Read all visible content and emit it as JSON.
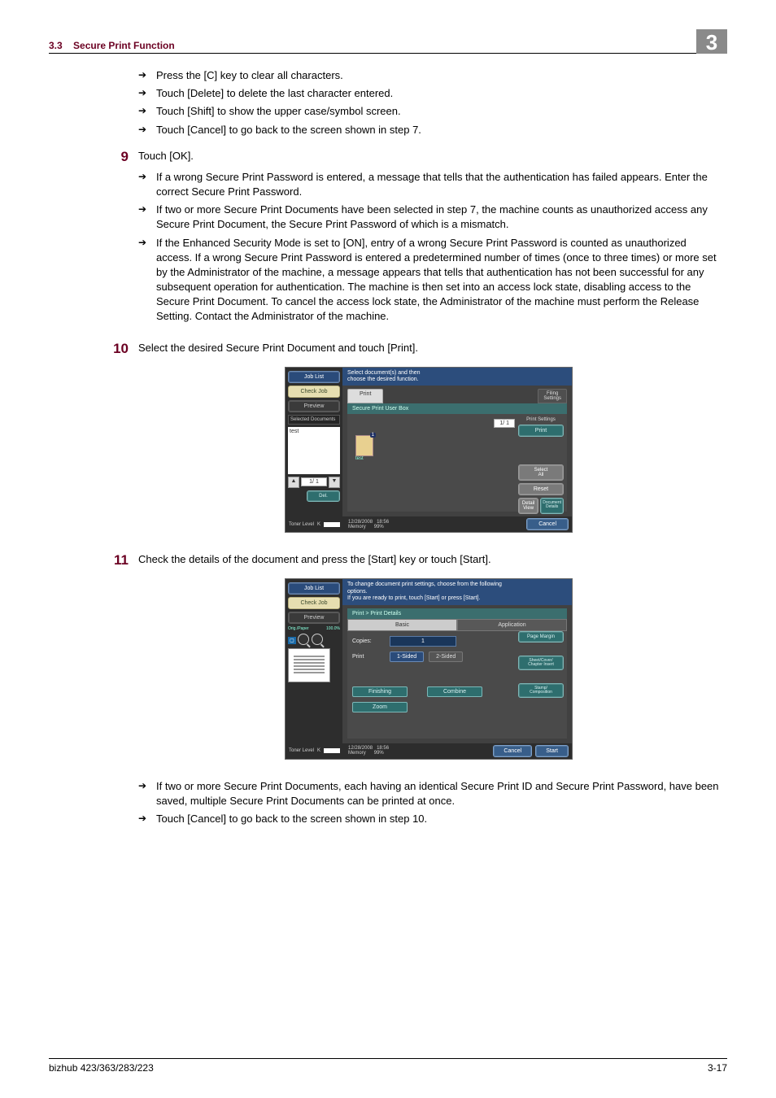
{
  "header": {
    "section_num": "3.3",
    "section_title": "Secure Print Function",
    "chapter": "3"
  },
  "intro_bullets": [
    "Press the [C] key to clear all characters.",
    "Touch [Delete] to delete the last character entered.",
    "Touch [Shift] to show the upper case/symbol screen.",
    "Touch [Cancel] to go back to the screen shown in step 7."
  ],
  "steps": {
    "s9": {
      "num": "9",
      "text": "Touch [OK].",
      "bullets": [
        "If a wrong Secure Print Password is entered, a message that tells that the authentication has failed appears. Enter the correct Secure Print Password.",
        "If two or more Secure Print Documents have been selected in step 7, the machine counts as unauthorized access any Secure Print Document, the Secure Print Password of which is a mismatch.",
        "If the Enhanced Security Mode is set to [ON], entry of a wrong Secure Print Password is counted as unauthorized access. If a wrong Secure Print Password is entered a predetermined number of times (once to three times) or more set by the Administrator of the machine, a message appears that tells that authentication has not been successful for any subsequent operation for authentication. The machine is then set into an access lock state, disabling access to the Secure Print Document. To cancel the access lock state, the Administrator of the machine must perform the Release Setting. Contact the Administrator of the machine."
      ]
    },
    "s10": {
      "num": "10",
      "text": "Select the desired Secure Print Document and touch [Print]."
    },
    "s11": {
      "num": "11",
      "text": "Check the details of the document and press the [Start] key or touch [Start].",
      "bullets": [
        "If two or more Secure Print Documents, each having an identical Secure Print ID and Secure Print Password, have been saved, multiple Secure Print Documents can be printed at once.",
        "Touch [Cancel] to go back to the screen shown in step 10."
      ]
    }
  },
  "screenshot1": {
    "left": {
      "job_list": "Job List",
      "check_job": "Check Job",
      "preview": "Preview",
      "sel_docs": "Selected Documents",
      "sel_test": "test",
      "page": "1/  1",
      "delete": "Del."
    },
    "instr": "Select document(s) and then\nchoose the desired function.",
    "tab_print": "Print",
    "tab_filing": "Filing\nSettings",
    "crumb": "Secure Print User Box",
    "doc_label": "test",
    "page_in": "1/  1",
    "right": {
      "print_settings": "Print Settings",
      "print": "Print",
      "select_all": "Select\nAll",
      "reset": "Reset",
      "detail_view": "Detail\nView",
      "doc_details": "Document\nDetails"
    },
    "toner": "Toner Level",
    "k": "K",
    "date": "12/28/2008",
    "time": "18:56",
    "memlbl": "Memory",
    "mem": "99%",
    "cancel": "Cancel"
  },
  "screenshot2": {
    "left": {
      "job_list": "Job List",
      "check_job": "Check Job",
      "preview": "Preview",
      "orig_paper": "Orig./Paper",
      "orig_paper_pct": "100.0%"
    },
    "instr": "To change document print settings, choose from the following\noptions.\nIf you are ready to print, touch [Start] or press [Start].",
    "crumb": "Print > Print Details",
    "tab_basic": "Basic",
    "tab_app": "Application",
    "copies_lbl": "Copies:",
    "copies_val": "1",
    "print_lbl": "Print",
    "oneside": "1-Sided",
    "twoside": "2-Sided",
    "finishing": "Finishing",
    "combine": "Combine",
    "zoom": "Zoom",
    "right": {
      "page_margin": "Page Margin",
      "sheet": "Sheet/Cover/\nChapter Insert",
      "stamp": "Stamp/\nComposition"
    },
    "toner": "Toner Level",
    "k": "K",
    "date": "12/28/2008",
    "time": "18:56",
    "memlbl": "Memory",
    "mem": "99%",
    "cancel": "Cancel",
    "start": "Start"
  },
  "footer": {
    "model": "bizhub 423/363/283/223",
    "page": "3-17"
  }
}
